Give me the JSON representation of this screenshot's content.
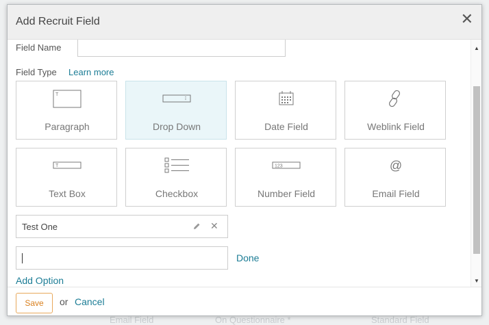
{
  "background": {
    "fragments": [
      "Email Field",
      "On Questionnaire *",
      "Standard Field"
    ]
  },
  "modal": {
    "title": "Add Recruit Field",
    "close_symbol": "✕",
    "field_name": {
      "label": "Field Name",
      "value": ""
    },
    "field_type": {
      "label": "Field Type",
      "learn_more": "Learn more"
    },
    "types": [
      {
        "label": "Paragraph",
        "icon": "paragraph-icon",
        "selected": false
      },
      {
        "label": "Drop Down",
        "icon": "dropdown-icon",
        "selected": true
      },
      {
        "label": "Date Field",
        "icon": "calendar-icon",
        "selected": false
      },
      {
        "label": "Weblink Field",
        "icon": "link-icon",
        "selected": false
      },
      {
        "label": "Text Box",
        "icon": "textbox-icon",
        "selected": false
      },
      {
        "label": "Checkbox",
        "icon": "checkbox-list-icon",
        "selected": false
      },
      {
        "label": "Number Field",
        "icon": "number-icon",
        "selected": false
      },
      {
        "label": "Email Field",
        "icon": "at-sign-icon",
        "selected": false
      }
    ],
    "options": [
      {
        "value": "Test One"
      }
    ],
    "new_option": {
      "value": "",
      "done": "Done"
    },
    "add_option": "Add Option",
    "footer": {
      "save": "Save",
      "or": "or",
      "cancel": "Cancel"
    },
    "colors": {
      "link": "#1b7c95",
      "selected_tile": "#eaf6f9",
      "save_border": "#e8a85a"
    }
  }
}
